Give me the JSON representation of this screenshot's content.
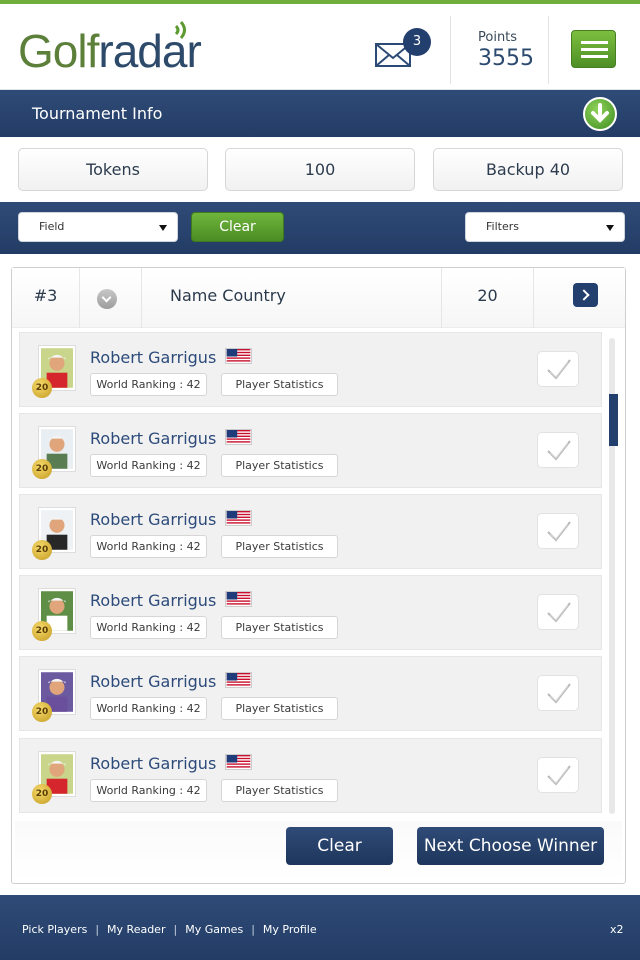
{
  "header": {
    "logo_part1": "Golf",
    "logo_part2": "radar",
    "mail_count": "3",
    "points_label": "Points",
    "points_value": "3555"
  },
  "tournament": {
    "title": "Tournament Info"
  },
  "tokens": {
    "left": "Tokens",
    "middle": "100",
    "right": "Backup 40"
  },
  "filters": {
    "field_select": "Field",
    "clear_label": "Clear",
    "filters_select": "Filters"
  },
  "panel": {
    "header": {
      "rank": "#3",
      "name_country": "Name Country",
      "number": "20"
    },
    "players": [
      {
        "name": "Robert Garrigus",
        "badge": "20",
        "ranking": "World Ranking : 42",
        "stats": "Player Statistics",
        "avatar_color": "#c9d58a",
        "shirt_color": "#d4262c"
      },
      {
        "name": "Robert Garrigus",
        "badge": "20",
        "ranking": "World Ranking : 42",
        "stats": "Player Statistics",
        "avatar_color": "#e9eef2",
        "shirt_color": "#5a7c52"
      },
      {
        "name": "Robert Garrigus",
        "badge": "20",
        "ranking": "World Ranking : 42",
        "stats": "Player Statistics",
        "avatar_color": "#eef2f5",
        "shirt_color": "#272727"
      },
      {
        "name": "Robert Garrigus",
        "badge": "20",
        "ranking": "World Ranking : 42",
        "stats": "Player Statistics",
        "avatar_color": "#5f8e46",
        "shirt_color": "#ffffff"
      },
      {
        "name": "Robert Garrigus",
        "badge": "20",
        "ranking": "World Ranking : 42",
        "stats": "Player Statistics",
        "avatar_color": "#6c5aa0",
        "shirt_color": "#6a4f9c"
      },
      {
        "name": "Robert Garrigus",
        "badge": "20",
        "ranking": "World Ranking : 42",
        "stats": "Player Statistics",
        "avatar_color": "#c9d58a",
        "shirt_color": "#d4262c"
      }
    ],
    "footer": {
      "clear_label": "Clear",
      "next_label": "Next Choose Winner"
    }
  },
  "footer": {
    "links": [
      "Pick Players",
      "My Reader",
      "My Games",
      "My Profile"
    ],
    "x2": "x2"
  },
  "colors": {
    "navy": "#233f6d",
    "green": "#5c9a2f",
    "name_blue": "#2c4a7a"
  }
}
